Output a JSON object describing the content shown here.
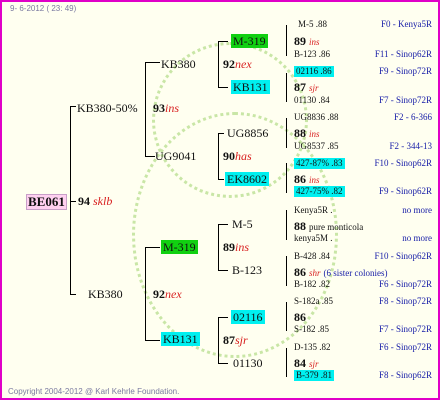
{
  "header": {
    "date": "9- 6-2012 ( 23: 49)"
  },
  "footer": {
    "copyright": "Copyright 2004-2012 @ Karl Kehrle Foundation."
  },
  "root": {
    "id": "BE061",
    "year": "94",
    "tag": "sklb"
  },
  "sire": {
    "id": "KB380-50%",
    "year": "93",
    "tag": "ins",
    "ss": {
      "id": "KB380",
      "year": "92",
      "tag": "nex",
      "sss": {
        "id": "M-319"
      },
      "ssd": {
        "id": "KB131"
      }
    },
    "sd": {
      "id": "UG9041",
      "year": "90",
      "tag": "has",
      "sds": {
        "id": "UG8856"
      },
      "sdd": {
        "id": "EK8602"
      }
    }
  },
  "dam": {
    "id": "KB380",
    "year": "92",
    "tag": "nex",
    "ds": {
      "id": "M-319",
      "year": "89",
      "tag": "ins",
      "dss": {
        "id": "M-5"
      },
      "dsd": {
        "id": "B-123"
      }
    },
    "dd": {
      "id": "KB131",
      "year": "87",
      "tag": "sjr",
      "dds": {
        "id": "02116"
      },
      "ddd": {
        "id": "01130"
      }
    }
  },
  "gen4": [
    {
      "a": "M-5 .88",
      "r": "F0 - Kenya5R"
    },
    {
      "y": "89",
      "tg": "ins"
    },
    {
      "a": "B-123 .86",
      "r": "F11 - Sinop62R"
    },
    {
      "a": "02116 .86",
      "r": "F9 - Sinop72R"
    },
    {
      "y": "87",
      "tg": "sjr"
    },
    {
      "a": "01130 .84",
      "r": "F7 - Sinop72R"
    },
    {
      "a": "UG8836 .88",
      "r": "F2 - 6-366"
    },
    {
      "y": "88",
      "tg": "ins"
    },
    {
      "a": "UG8537 .85",
      "r": "F2 - 344-13"
    },
    {
      "a": "427-87% .83",
      "r": "F10 - Sinop62R"
    },
    {
      "y": "86",
      "tg": "ins"
    },
    {
      "a": "427-75% .82",
      "r": "F9 - Sinop62R"
    },
    {
      "a": "Kenya5R .",
      "r": "no more"
    },
    {
      "y": "88",
      "tg": "pure monticola"
    },
    {
      "a": "kenya5M .",
      "r": "no more"
    },
    {
      "a": "B-428 .84",
      "r": "F10 - Sinop62R"
    },
    {
      "y": "86",
      "tg": "shr",
      "extra": "(6 sister colonies)"
    },
    {
      "a": "B-182 .82",
      "r": "F6 - Sinop72R"
    },
    {
      "a": "S-182a .85",
      "r": "F8 - Sinop72R"
    },
    {
      "y": "86",
      "tg": ""
    },
    {
      "a": "S-182 .85",
      "r": "F7 - Sinop72R"
    },
    {
      "a": "D-135 .82",
      "r": "F6 - Sinop72R"
    },
    {
      "y": "84",
      "tg": "sjr"
    },
    {
      "a": "B-379 .81",
      "r": "F8 - Sinop62R"
    }
  ]
}
